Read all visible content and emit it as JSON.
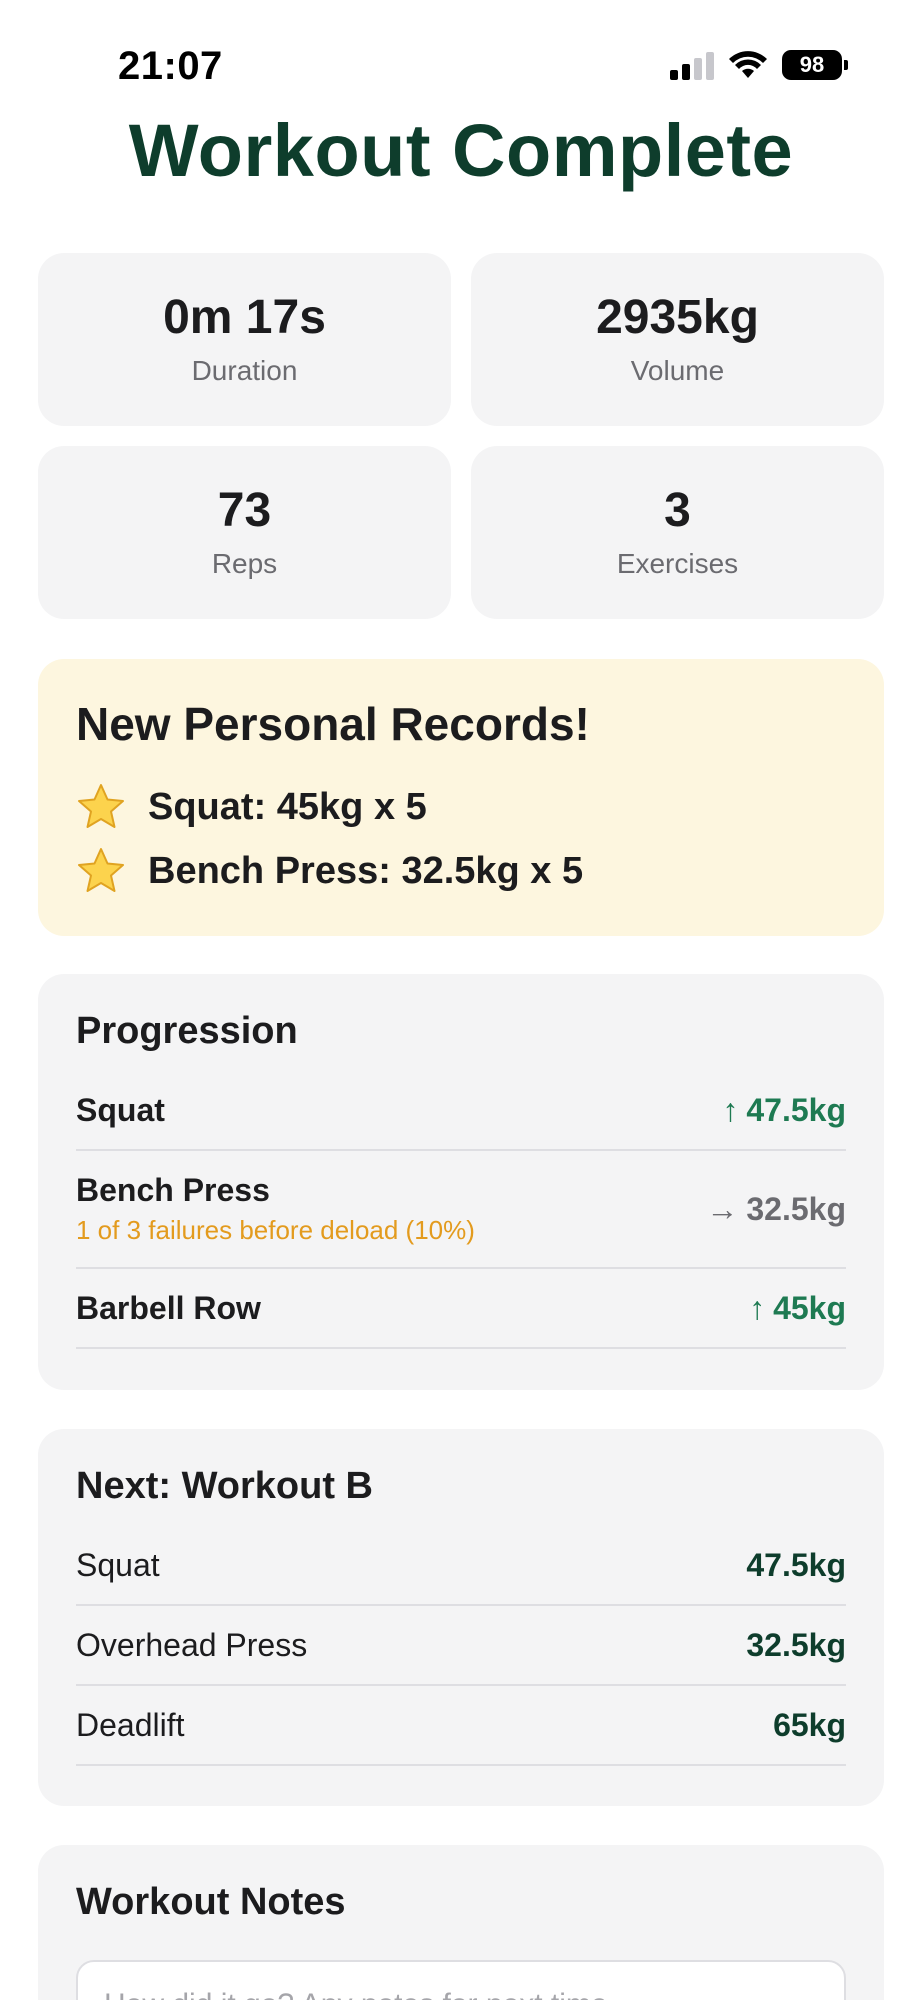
{
  "status_bar": {
    "time": "21:07",
    "battery": "98",
    "icons": [
      "cellular-signal-icon",
      "wifi-icon",
      "battery-icon"
    ]
  },
  "title": "Workout Complete",
  "stats": [
    {
      "value": "0m 17s",
      "label": "Duration"
    },
    {
      "value": "2935kg",
      "label": "Volume"
    },
    {
      "value": "73",
      "label": "Reps"
    },
    {
      "value": "3",
      "label": "Exercises"
    }
  ],
  "records": {
    "title": "New Personal Records!",
    "icon": "star-icon",
    "items": [
      {
        "text": "Squat: 45kg x 5"
      },
      {
        "text": "Bench Press: 32.5kg x 5"
      }
    ]
  },
  "progression": {
    "title": "Progression",
    "items": [
      {
        "name": "Squat",
        "arrow": "↑",
        "value": "47.5kg",
        "trend": "up",
        "note": ""
      },
      {
        "name": "Bench Press",
        "arrow": "→",
        "value": "32.5kg",
        "trend": "flat",
        "note": "1 of 3 failures before deload (10%)"
      },
      {
        "name": "Barbell Row",
        "arrow": "↑",
        "value": "45kg",
        "trend": "up",
        "note": ""
      }
    ]
  },
  "next_workout": {
    "title": "Next: Workout B",
    "items": [
      {
        "name": "Squat",
        "value": "47.5kg"
      },
      {
        "name": "Overhead Press",
        "value": "32.5kg"
      },
      {
        "name": "Deadlift",
        "value": "65kg"
      }
    ]
  },
  "notes": {
    "title": "Workout Notes",
    "placeholder": "How did it go? Any notes for next time..."
  },
  "colors": {
    "title_green": "#0e3d2c",
    "up_green": "#1e7a52",
    "warning_orange": "#e39b1e",
    "record_bg": "#fdf6df",
    "card_bg": "#f4f4f5"
  }
}
